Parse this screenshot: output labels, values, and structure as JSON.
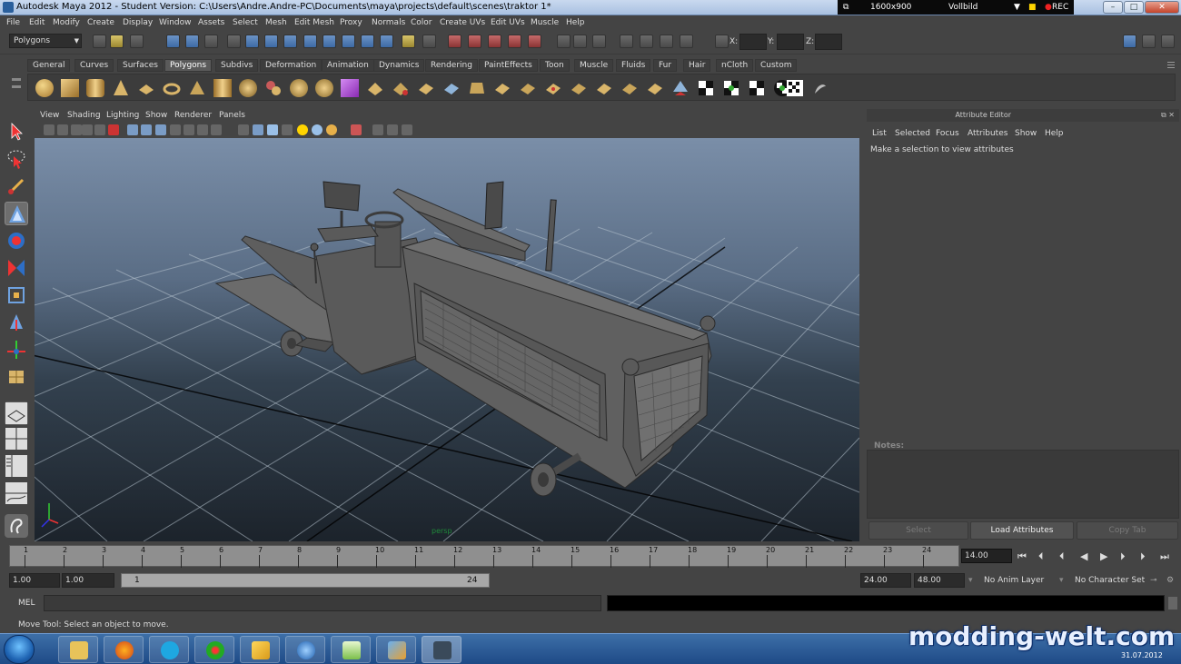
{
  "window": {
    "title": "Autodesk Maya 2012 - Student Version: C:\\Users\\Andre.Andre-PC\\Documents\\maya\\projects\\default\\scenes\\traktor 1*",
    "resolution": "1600x900",
    "capture_mode": "Vollbild",
    "rec_label": "REC"
  },
  "menubar": [
    "File",
    "Edit",
    "Modify",
    "Create",
    "Display",
    "Window",
    "Assets",
    "Select",
    "Mesh",
    "Edit Mesh",
    "Proxy",
    "Normals",
    "Color",
    "Create UVs",
    "Edit UVs",
    "Muscle",
    "Help"
  ],
  "statusline": {
    "mode": "Polygons",
    "x_label": "X:",
    "y_label": "Y:",
    "z_label": "Z:"
  },
  "shelf": {
    "tabs": [
      "General",
      "Curves",
      "Surfaces",
      "Polygons",
      "Subdivs",
      "Deformation",
      "Animation",
      "Dynamics",
      "Rendering",
      "PaintEffects",
      "Toon",
      "Muscle",
      "Fluids",
      "Fur",
      "Hair",
      "nCloth",
      "Custom"
    ],
    "selected": "Polygons"
  },
  "viewport": {
    "menu": [
      "View",
      "Shading",
      "Lighting",
      "Show",
      "Renderer",
      "Panels"
    ],
    "camera_label": "persp"
  },
  "attribute_editor": {
    "title": "Attribute Editor",
    "menu": [
      "List",
      "Selected",
      "Focus",
      "Attributes",
      "Show",
      "Help"
    ],
    "message": "Make a selection to view attributes",
    "notes_label": "Notes:",
    "buttons": {
      "select": "Select",
      "load": "Load Attributes",
      "copy": "Copy Tab"
    }
  },
  "timeline": {
    "ticks": [
      "1",
      "2",
      "3",
      "4",
      "5",
      "6",
      "7",
      "8",
      "9",
      "10",
      "11",
      "12",
      "13",
      "14",
      "15",
      "16",
      "17",
      "18",
      "19",
      "20",
      "21",
      "22",
      "23",
      "24"
    ],
    "current_frame": "14.00"
  },
  "range": {
    "start": "1.00",
    "playback_start": "1.00",
    "range_start": "1",
    "range_end": "24",
    "playback_end": "24.00",
    "end": "48.00",
    "anim_layer": "No Anim Layer",
    "character_set": "No Character Set"
  },
  "command_line": {
    "label": "MEL"
  },
  "help_line": "Move Tool: Select an object to move.",
  "taskbar": {
    "watermark": "modding-welt.com",
    "date": "31.07.2012"
  }
}
